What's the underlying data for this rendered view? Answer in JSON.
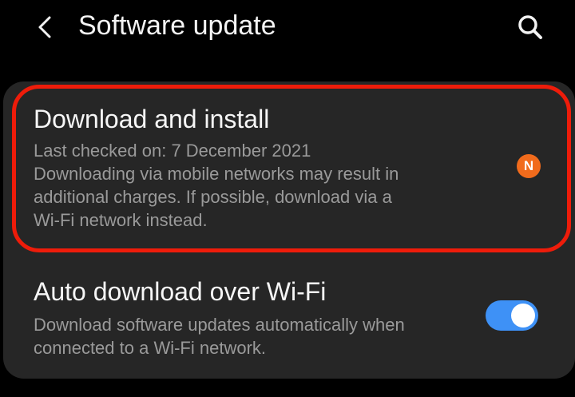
{
  "header": {
    "title": "Software update",
    "back_icon": "back-chevron-icon",
    "search_icon": "search-icon"
  },
  "download_install": {
    "title": "Download and install",
    "last_checked": "Last checked on: 7 December 2021",
    "note_line1": "Downloading via mobile networks may result in",
    "note_line2": "additional charges. If possible, download via a",
    "note_line3": "Wi-Fi network instead.",
    "badge": "N",
    "highlight_color": "#ee1c0a",
    "badge_color": "#f16b1c"
  },
  "auto_download": {
    "title": "Auto download over Wi-Fi",
    "desc_line1": "Download software updates automatically when",
    "desc_line2": "connected to a Wi-Fi network.",
    "toggle_on": true,
    "toggle_color": "#3e91f6"
  }
}
